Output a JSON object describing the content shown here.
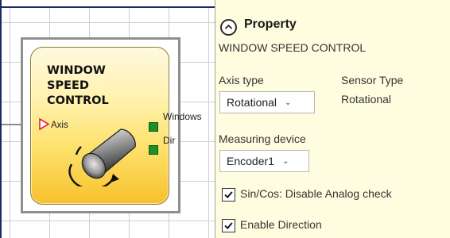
{
  "canvas": {
    "block": {
      "title": "WINDOW\nSPEED\nCONTROL",
      "input_label": "Axis",
      "outputs": [
        {
          "label": "Windows"
        },
        {
          "label": "Dir"
        }
      ]
    }
  },
  "property_panel": {
    "title": "Property",
    "block_name": "WINDOW SPEED CONTROL",
    "axis_type_label": "Axis type",
    "axis_type_value": "Rotational",
    "sensor_type_label": "Sensor Type",
    "sensor_type_value": "Rotational",
    "measuring_device_label": "Measuring device",
    "measuring_device_value": "Encoder1",
    "checkboxes": [
      {
        "label": "Sin/Cos: Disable Analog check",
        "checked": true
      },
      {
        "label": "Enable Direction",
        "checked": true
      }
    ]
  },
  "colors": {
    "panel_background": "#fffde0",
    "block_gradient_bottom": "#f8c12c",
    "output_pin": "#1f8f2a",
    "input_marker": "#e0263a"
  }
}
